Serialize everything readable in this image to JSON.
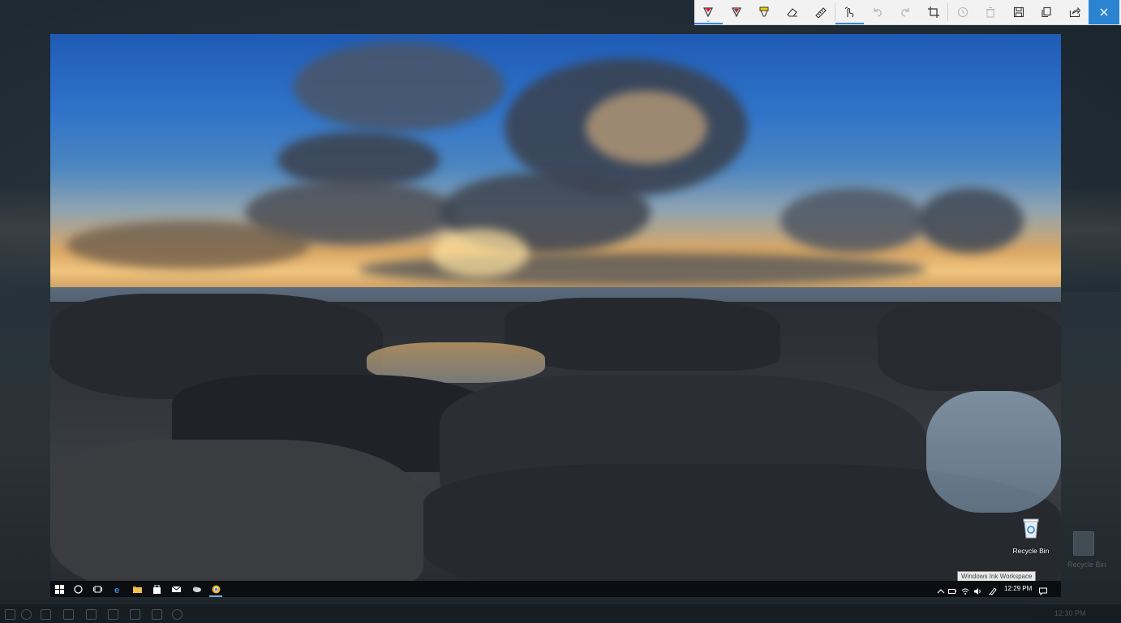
{
  "toolbar": {
    "buttons": [
      {
        "name": "ballpoint-pen-button",
        "icon": "ballpoint-pen-icon",
        "color": "#d0202a"
      },
      {
        "name": "pencil-button",
        "icon": "pencil-icon",
        "color": "#c0262e"
      },
      {
        "name": "highlighter-button",
        "icon": "highlighter-icon",
        "color": "#f4d000"
      },
      {
        "name": "eraser-button",
        "icon": "eraser-icon"
      },
      {
        "name": "ruler-button",
        "icon": "ruler-icon"
      },
      {
        "name": "touch-writing-button",
        "icon": "touch-writing-icon"
      },
      {
        "name": "undo-button",
        "icon": "undo-icon"
      },
      {
        "name": "redo-button",
        "icon": "redo-icon"
      },
      {
        "name": "crop-button",
        "icon": "crop-icon"
      },
      {
        "name": "clear-history-button",
        "icon": "history-icon"
      },
      {
        "name": "delete-button",
        "icon": "trash-icon"
      },
      {
        "name": "save-button",
        "icon": "save-icon"
      },
      {
        "name": "copy-button",
        "icon": "copy-icon"
      },
      {
        "name": "share-button",
        "icon": "share-icon"
      },
      {
        "name": "close-button",
        "icon": "close-icon"
      }
    ],
    "accent_color": "#2a84d2"
  },
  "desktop": {
    "recycle_bin_label": "Recycle Bin",
    "tooltip": "Windows Ink Workspace"
  },
  "taskbar": {
    "clock": "12:29 PM",
    "pinned_icons": [
      "start-icon",
      "cortana-icon",
      "task-view-icon",
      "edge-icon",
      "file-explorer-icon",
      "store-icon",
      "mail-icon",
      "cloud-app-icon",
      "chrome-icon"
    ],
    "tray_icons": [
      "chevron-up-icon",
      "battery-icon",
      "wifi-icon",
      "volume-icon",
      "pen-ink-icon"
    ]
  },
  "background_desktop": {
    "recycle_bin_label": "Recycle Bin",
    "clock": "12:30 PM"
  }
}
